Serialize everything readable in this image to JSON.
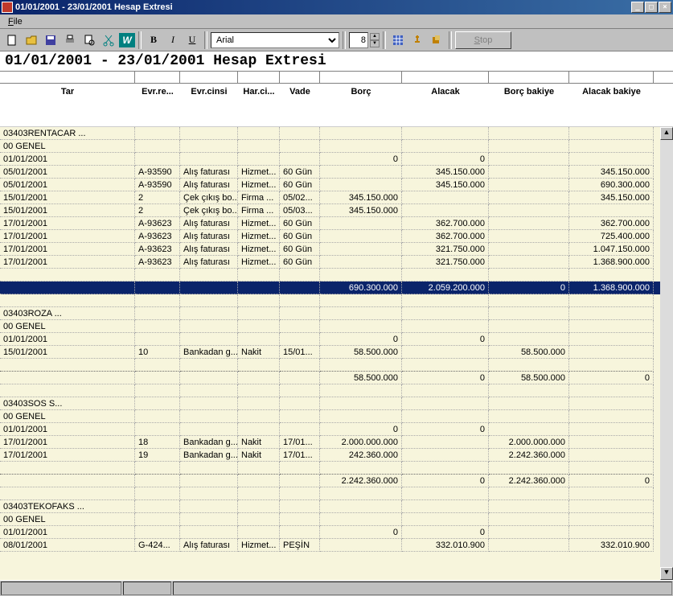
{
  "window": {
    "title": "01/01/2001 - 23/01/2001 Hesap Extresi"
  },
  "menu": {
    "file": "File"
  },
  "toolbar": {
    "font_name": "Arial",
    "font_size": "8",
    "stop_label": "Stop",
    "bold": "B",
    "italic": "I",
    "underline": "U"
  },
  "doc_title": "01/01/2001 - 23/01/2001 Hesap Extresi",
  "headers": {
    "tar": "Tar",
    "evrre": "Evr.re...",
    "evrc": "Evr.cinsi",
    "harc": "Har.ci...",
    "vade": "Vade",
    "borc": "Borç",
    "alac": "Alacak",
    "borcb": "Borç bakiye",
    "alacb": "Alacak bakiye"
  },
  "rows": [
    {
      "c0": "03403RENTACAR   ...",
      "c1": "",
      "c2": "",
      "c3": "",
      "c4": "",
      "c5": "",
      "c6": "",
      "c7": "",
      "c8": ""
    },
    {
      "c0": "00            GENEL",
      "c1": "",
      "c2": "",
      "c3": "",
      "c4": "",
      "c5": "",
      "c6": "",
      "c7": "",
      "c8": ""
    },
    {
      "c0": "01/01/2001",
      "c1": "",
      "c2": "",
      "c3": "",
      "c4": "",
      "c5": "0",
      "c6": "0",
      "c7": "",
      "c8": ""
    },
    {
      "c0": "05/01/2001",
      "c1": "A-93590",
      "c2": "Alış faturası",
      "c3": "Hizmet...",
      "c4": "60 Gün",
      "c5": "",
      "c6": "345.150.000",
      "c7": "",
      "c8": "345.150.000"
    },
    {
      "c0": "05/01/2001",
      "c1": "A-93590",
      "c2": "Alış faturası",
      "c3": "Hizmet...",
      "c4": "60 Gün",
      "c5": "",
      "c6": "345.150.000",
      "c7": "",
      "c8": "690.300.000"
    },
    {
      "c0": "15/01/2001",
      "c1": "2",
      "c2": "Çek çıkış bo...",
      "c3": "Firma ...",
      "c4": "05/02...",
      "c5": "345.150.000",
      "c6": "",
      "c7": "",
      "c8": "345.150.000"
    },
    {
      "c0": "15/01/2001",
      "c1": "2",
      "c2": "Çek çıkış bo...",
      "c3": "Firma ...",
      "c4": "05/03...",
      "c5": "345.150.000",
      "c6": "",
      "c7": "",
      "c8": ""
    },
    {
      "c0": "17/01/2001",
      "c1": "A-93623",
      "c2": "Alış faturası",
      "c3": "Hizmet...",
      "c4": "60 Gün",
      "c5": "",
      "c6": "362.700.000",
      "c7": "",
      "c8": "362.700.000"
    },
    {
      "c0": "17/01/2001",
      "c1": "A-93623",
      "c2": "Alış faturası",
      "c3": "Hizmet...",
      "c4": "60 Gün",
      "c5": "",
      "c6": "362.700.000",
      "c7": "",
      "c8": "725.400.000"
    },
    {
      "c0": "17/01/2001",
      "c1": "A-93623",
      "c2": "Alış faturası",
      "c3": "Hizmet...",
      "c4": "60 Gün",
      "c5": "",
      "c6": "321.750.000",
      "c7": "",
      "c8": "1.047.150.000"
    },
    {
      "c0": "17/01/2001",
      "c1": "A-93623",
      "c2": "Alış faturası",
      "c3": "Hizmet...",
      "c4": "60 Gün",
      "c5": "",
      "c6": "321.750.000",
      "c7": "",
      "c8": "1.368.900.000"
    },
    {
      "c0": "",
      "c1": "",
      "c2": "",
      "c3": "",
      "c4": "",
      "c5": "",
      "c6": "",
      "c7": "",
      "c8": ""
    },
    {
      "sel": true,
      "c0": "",
      "c1": "",
      "c2": "",
      "c3": "",
      "c4": "",
      "c5": "690.300.000",
      "c6": "2.059.200.000",
      "c7": "0",
      "c8": "1.368.900.000"
    },
    {
      "c0": "",
      "c1": "",
      "c2": "",
      "c3": "",
      "c4": "",
      "c5": "",
      "c6": "",
      "c7": "",
      "c8": ""
    },
    {
      "c0": "03403ROZA        ...",
      "c1": "",
      "c2": "",
      "c3": "",
      "c4": "",
      "c5": "",
      "c6": "",
      "c7": "",
      "c8": ""
    },
    {
      "c0": "00            GENEL",
      "c1": "",
      "c2": "",
      "c3": "",
      "c4": "",
      "c5": "",
      "c6": "",
      "c7": "",
      "c8": ""
    },
    {
      "c0": "01/01/2001",
      "c1": "",
      "c2": "",
      "c3": "",
      "c4": "",
      "c5": "0",
      "c6": "0",
      "c7": "",
      "c8": ""
    },
    {
      "c0": "15/01/2001",
      "c1": "10",
      "c2": "Bankadan g...",
      "c3": "Nakit",
      "c4": "15/01...",
      "c5": "58.500.000",
      "c6": "",
      "c7": "58.500.000",
      "c8": ""
    },
    {
      "dotted": true,
      "c0": "",
      "c1": "",
      "c2": "",
      "c3": "",
      "c4": "",
      "c5": "",
      "c6": "",
      "c7": "",
      "c8": ""
    },
    {
      "c0": "",
      "c1": "",
      "c2": "",
      "c3": "",
      "c4": "",
      "c5": "58.500.000",
      "c6": "0",
      "c7": "58.500.000",
      "c8": "0"
    },
    {
      "c0": "",
      "c1": "",
      "c2": "",
      "c3": "",
      "c4": "",
      "c5": "",
      "c6": "",
      "c7": "",
      "c8": ""
    },
    {
      "c0": "03403SOS       S...",
      "c1": "",
      "c2": "",
      "c3": "",
      "c4": "",
      "c5": "",
      "c6": "",
      "c7": "",
      "c8": ""
    },
    {
      "c0": "00            GENEL",
      "c1": "",
      "c2": "",
      "c3": "",
      "c4": "",
      "c5": "",
      "c6": "",
      "c7": "",
      "c8": ""
    },
    {
      "c0": "01/01/2001",
      "c1": "",
      "c2": "",
      "c3": "",
      "c4": "",
      "c5": "0",
      "c6": "0",
      "c7": "",
      "c8": ""
    },
    {
      "c0": "17/01/2001",
      "c1": "18",
      "c2": "Bankadan g...",
      "c3": "Nakit",
      "c4": "17/01...",
      "c5": "2.000.000.000",
      "c6": "",
      "c7": "2.000.000.000",
      "c8": ""
    },
    {
      "c0": "17/01/2001",
      "c1": "19",
      "c2": "Bankadan g...",
      "c3": "Nakit",
      "c4": "17/01...",
      "c5": "242.360.000",
      "c6": "",
      "c7": "2.242.360.000",
      "c8": ""
    },
    {
      "dotted": true,
      "c0": "",
      "c1": "",
      "c2": "",
      "c3": "",
      "c4": "",
      "c5": "",
      "c6": "",
      "c7": "",
      "c8": ""
    },
    {
      "c0": "",
      "c1": "",
      "c2": "",
      "c3": "",
      "c4": "",
      "c5": "2.242.360.000",
      "c6": "0",
      "c7": "2.242.360.000",
      "c8": "0"
    },
    {
      "c0": "",
      "c1": "",
      "c2": "",
      "c3": "",
      "c4": "",
      "c5": "",
      "c6": "",
      "c7": "",
      "c8": ""
    },
    {
      "c0": "03403TEKOFAKS  ...",
      "c1": "",
      "c2": "",
      "c3": "",
      "c4": "",
      "c5": "",
      "c6": "",
      "c7": "",
      "c8": ""
    },
    {
      "c0": "00            GENEL",
      "c1": "",
      "c2": "",
      "c3": "",
      "c4": "",
      "c5": "",
      "c6": "",
      "c7": "",
      "c8": ""
    },
    {
      "c0": "01/01/2001",
      "c1": "",
      "c2": "",
      "c3": "",
      "c4": "",
      "c5": "0",
      "c6": "0",
      "c7": "",
      "c8": ""
    },
    {
      "c0": "08/01/2001",
      "c1": "G-424...",
      "c2": "Alış faturası",
      "c3": "Hizmet...",
      "c4": "PEŞİN",
      "c5": "",
      "c6": "332.010.900",
      "c7": "",
      "c8": "332.010.900"
    }
  ],
  "ruler_widths": [
    168,
    56,
    72,
    52,
    50,
    102,
    108,
    100,
    105
  ]
}
